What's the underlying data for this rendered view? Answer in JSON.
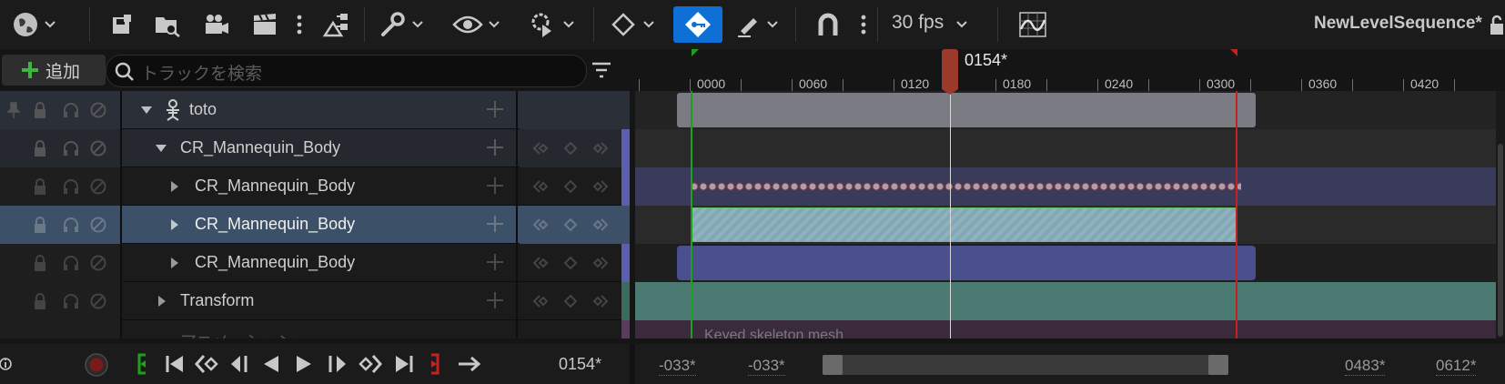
{
  "toolbar": {
    "fps": "30 fps",
    "sequence_title": "NewLevelSequence*"
  },
  "outliner": {
    "add_label": "追加",
    "search_placeholder": "トラックを検索",
    "rows": [
      {
        "label": "toto"
      },
      {
        "label": "CR_Mannequin_Body"
      },
      {
        "label": "CR_Mannequin_Body"
      },
      {
        "label": "CR_Mannequin_Body"
      },
      {
        "label": "CR_Mannequin_Body"
      },
      {
        "label": "Transform"
      },
      {
        "label": "アニメーション"
      }
    ]
  },
  "timeline": {
    "playhead_label": "0154*",
    "ticks": [
      "0000",
      "0060",
      "0120",
      "0180",
      "0240",
      "0300",
      "0360",
      "0420"
    ],
    "partial_section_label": "Keyed  skeleton mesh"
  },
  "transport": {
    "current_frame": "0154*",
    "view_start": "-033*",
    "working_start": "-033*",
    "working_end": "0483*",
    "view_end": "0612*"
  },
  "colors": {
    "accent_blue": "#0e70d6",
    "start_marker": "#1aa31a",
    "end_marker": "#c42222",
    "playhead": "#9b3a2a"
  }
}
